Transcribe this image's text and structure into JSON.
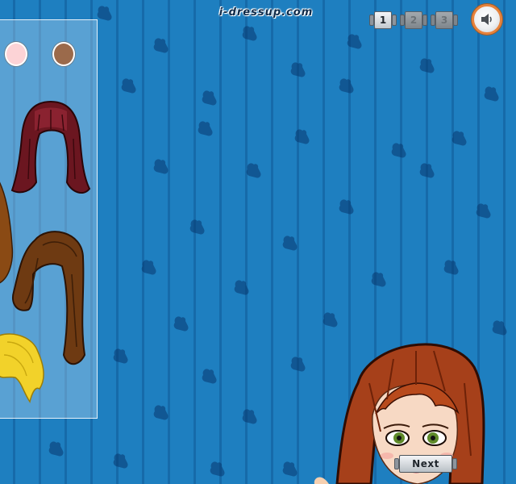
{
  "site": {
    "logo_text": "i-dressup.com"
  },
  "page_nav": {
    "pages": [
      {
        "label": "1",
        "state": "active"
      },
      {
        "label": "2",
        "state": "inactive"
      },
      {
        "label": "3",
        "state": "inactive"
      }
    ]
  },
  "sound": {
    "icon": "speaker-icon"
  },
  "hair_panel": {
    "swatches": [
      {
        "name": "pink-skin",
        "color": "#fcd3d6"
      },
      {
        "name": "brown-skin",
        "color": "#9b6a4b"
      }
    ],
    "options": [
      {
        "name": "burgundy-straight-hair",
        "color": "#6b1620"
      },
      {
        "name": "brown-long-hair",
        "color": "#6e3a12"
      },
      {
        "name": "blonde-short-hair",
        "color": "#f2d22a"
      },
      {
        "name": "brown-partial-hair",
        "color": "#8a4a14"
      }
    ]
  },
  "colors": {
    "background": "#1e7fc0",
    "model_hair": "#a6401a",
    "eyes": "#5f8a2a"
  },
  "next_button": {
    "label": "Next"
  }
}
